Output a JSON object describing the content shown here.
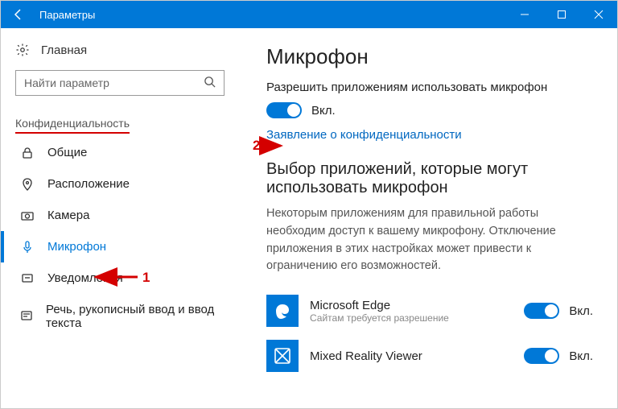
{
  "titlebar": {
    "title": "Параметры"
  },
  "sidebar": {
    "home": "Главная",
    "search_placeholder": "Найти параметр",
    "section": "Конфиденциальность",
    "items": [
      {
        "label": "Общие"
      },
      {
        "label": "Расположение"
      },
      {
        "label": "Камера"
      },
      {
        "label": "Микрофон"
      },
      {
        "label": "Уведомления"
      },
      {
        "label": "Речь, рукописный ввод и ввод текста"
      }
    ]
  },
  "main": {
    "heading": "Микрофон",
    "permission_label": "Разрешить приложениям использовать микрофон",
    "toggle_on": "Вкл.",
    "privacy_link": "Заявление о конфиденциальности",
    "choose_heading": "Выбор приложений, которые могут использовать микрофон",
    "choose_desc": "Некоторым приложениям для правильной работы необходим доступ к вашему микрофону. Отключение приложения в этих настройках может привести к ограничению его возможностей.",
    "apps": [
      {
        "name": "Microsoft Edge",
        "sub": "Сайтам требуется разрешение",
        "toggle": "Вкл."
      },
      {
        "name": "Mixed Reality Viewer",
        "sub": "",
        "toggle": "Вкл."
      }
    ]
  },
  "annotations": {
    "n1": "1",
    "n2": "2"
  }
}
